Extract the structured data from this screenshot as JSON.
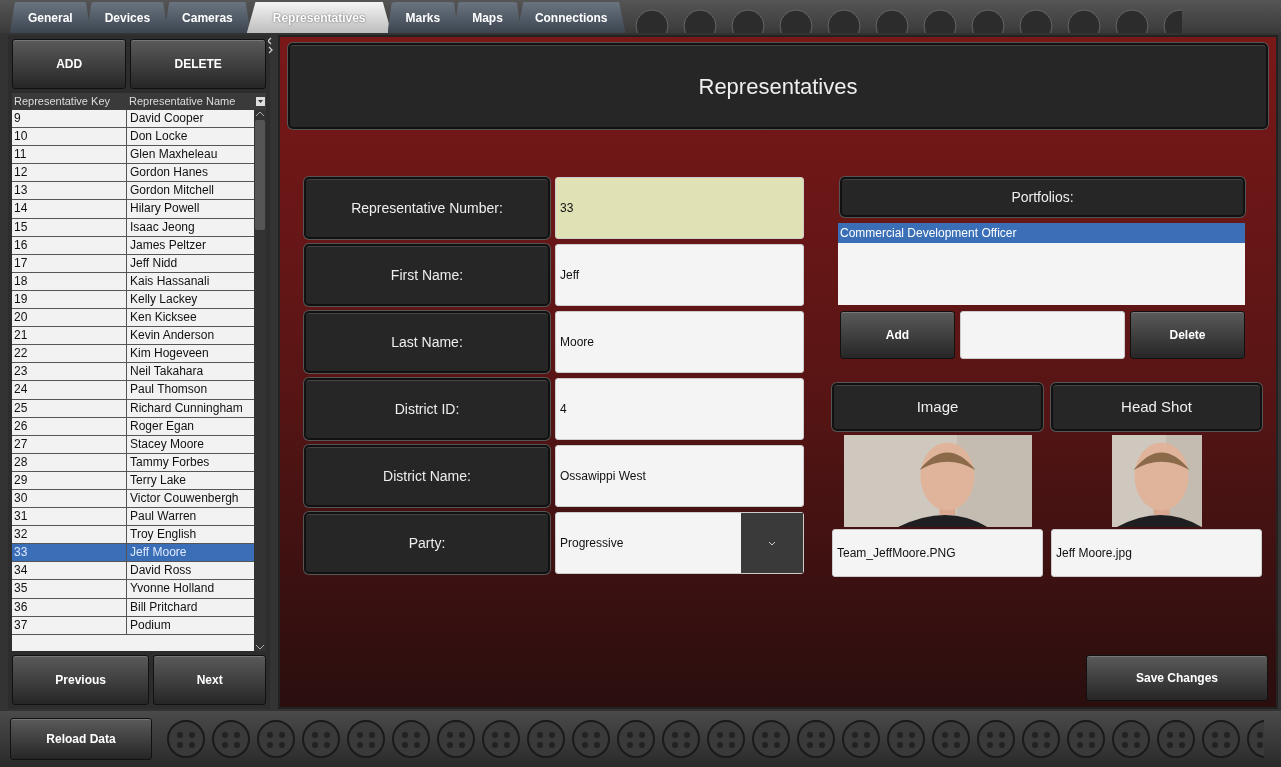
{
  "tabs": [
    {
      "label": "General",
      "selected": false
    },
    {
      "label": "Devices",
      "selected": false
    },
    {
      "label": "Cameras",
      "selected": false
    },
    {
      "label": "Representatives",
      "selected": true
    },
    {
      "label": "Marks",
      "selected": false
    },
    {
      "label": "Maps",
      "selected": false
    },
    {
      "label": "Connections",
      "selected": false
    }
  ],
  "list_panel": {
    "top_buttons": [
      "ADD",
      "DELETE"
    ],
    "table": {
      "columns": [
        "Representative Key",
        "Representative Name"
      ],
      "rows": [
        {
          "key": "9",
          "name": "David Cooper",
          "selected": false
        },
        {
          "key": "10",
          "name": "Don Locke",
          "selected": false
        },
        {
          "key": "11",
          "name": "Glen Maxheleau",
          "selected": false
        },
        {
          "key": "12",
          "name": "Gordon Hanes",
          "selected": false
        },
        {
          "key": "13",
          "name": "Gordon Mitchell",
          "selected": false
        },
        {
          "key": "14",
          "name": "Hilary Powell",
          "selected": false
        },
        {
          "key": "15",
          "name": "Isaac Jeong",
          "selected": false
        },
        {
          "key": "16",
          "name": "James Peltzer",
          "selected": false
        },
        {
          "key": "17",
          "name": "Jeff Nidd",
          "selected": false
        },
        {
          "key": "18",
          "name": "Kais Hassanali",
          "selected": false
        },
        {
          "key": "19",
          "name": "Kelly Lackey",
          "selected": false
        },
        {
          "key": "20",
          "name": "Ken Kicksee",
          "selected": false
        },
        {
          "key": "21",
          "name": "Kevin Anderson",
          "selected": false
        },
        {
          "key": "22",
          "name": "Kim Hogeveen",
          "selected": false
        },
        {
          "key": "23",
          "name": "Neil Takahara",
          "selected": false
        },
        {
          "key": "24",
          "name": "Paul Thomson",
          "selected": false
        },
        {
          "key": "25",
          "name": "Richard Cunningham",
          "selected": false
        },
        {
          "key": "26",
          "name": "Roger Egan",
          "selected": false
        },
        {
          "key": "27",
          "name": "Stacey Moore",
          "selected": false
        },
        {
          "key": "28",
          "name": "Tammy Forbes",
          "selected": false
        },
        {
          "key": "29",
          "name": "Terry Lake",
          "selected": false
        },
        {
          "key": "30",
          "name": "Victor Couwenbergh",
          "selected": false
        },
        {
          "key": "31",
          "name": "Paul Warren",
          "selected": false
        },
        {
          "key": "32",
          "name": "Troy English",
          "selected": false
        },
        {
          "key": "33",
          "name": "Jeff Moore",
          "selected": true
        },
        {
          "key": "34",
          "name": "David Ross",
          "selected": false
        },
        {
          "key": "35",
          "name": "Yvonne Holland",
          "selected": false
        },
        {
          "key": "36",
          "name": "Bill Pritchard",
          "selected": false
        },
        {
          "key": "37",
          "name": "Podium",
          "selected": false
        }
      ]
    },
    "bottom_buttons": [
      "Previous",
      "Next"
    ]
  },
  "form": {
    "title": "Representatives",
    "fields": [
      {
        "label": "Representative Number:",
        "value": "33",
        "kind": "text",
        "highlighted": true
      },
      {
        "label": "First Name:",
        "value": "Jeff",
        "kind": "text",
        "highlighted": false
      },
      {
        "label": "Last Name:",
        "value": "Moore",
        "kind": "text",
        "highlighted": false
      },
      {
        "label": "District ID:",
        "value": "4",
        "kind": "text",
        "highlighted": false
      },
      {
        "label": "District Name:",
        "value": "Ossawippi West",
        "kind": "text",
        "highlighted": false
      },
      {
        "label": "Party:",
        "value": "Progressive",
        "kind": "select",
        "highlighted": false
      }
    ],
    "portfolios": {
      "label": "Portfolios:",
      "items": [
        {
          "text": "Commercial Development Officer",
          "selected": true
        }
      ],
      "add_button": "Add",
      "delete_button": "Delete"
    },
    "images": [
      {
        "label": "Image",
        "filename": "Team_JeffMoore.PNG",
        "kind": "picture"
      },
      {
        "label": "Head Shot",
        "filename": "Jeff Moore.jpg",
        "kind": "picture"
      }
    ],
    "save_button": "Save Changes"
  },
  "footer": {
    "reload_button": "Reload Data"
  }
}
